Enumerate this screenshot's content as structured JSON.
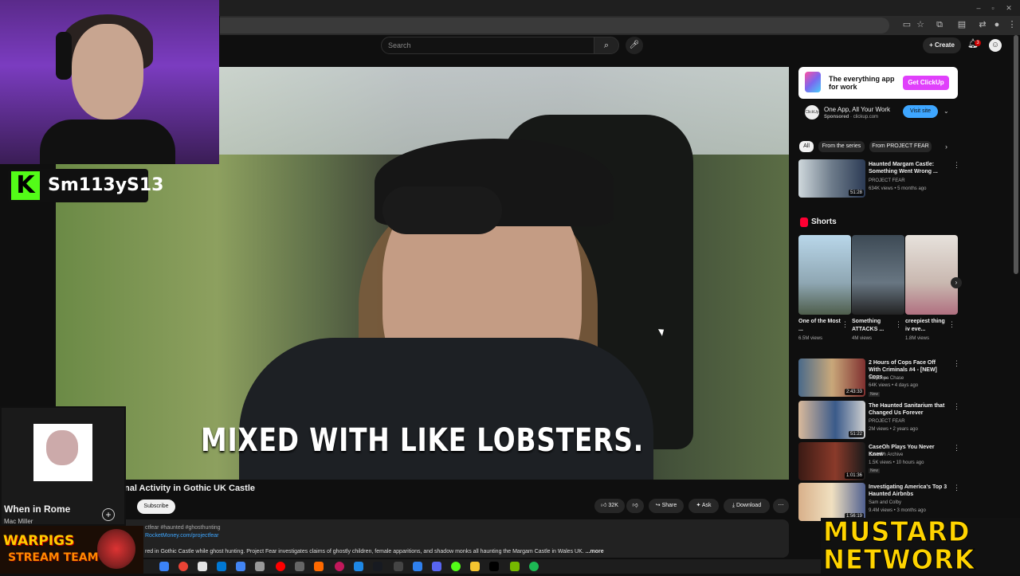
{
  "youtube": {
    "search_placeholder": "Search",
    "create_label": "Create",
    "notification_count": "3"
  },
  "video": {
    "caption": "MIXED WITH LIKE LOBSTERS.",
    "title_fragment": "nal Activity in Gothic UK Castle",
    "subscribe_label": "Subscribe",
    "likes": "32K",
    "share_label": "Share",
    "ask_label": "Ask",
    "download_label": "Download",
    "desc_tags": "ctfear #haunted #ghosthunting",
    "desc_link": "RocketMoney.com/projectfear",
    "desc_text": "red in Gothic Castle while ghost hunting. Project Fear investigates claims of ghostly children, female apparitions,  and shadow monks all haunting the Margam Castle in Wales UK.",
    "desc_more": "...more"
  },
  "ad": {
    "headline": "The everything app for work",
    "cta": "Get ClickUp",
    "icon_text": "ClickUp",
    "title": "One App, All Your Work",
    "sponsored": "Sponsored",
    "domain": "clickup.com",
    "visit": "Visit site"
  },
  "chips": [
    "All",
    "From the series",
    "From PROJECT FEAR"
  ],
  "recommended": [
    {
      "title": "Haunted Margam Castle: Something Went Wrong ...",
      "channel": "PROJECT FEAR",
      "meta": "634K views • 5 months ago",
      "duration": "51:28",
      "badge": ""
    },
    {
      "title": "2 Hours of Cops Face Off With Criminals #4 - [NEW] Cops ...",
      "channel": "911 Cops Chase",
      "meta": "64K views • 4 days ago",
      "duration": "2:43:33",
      "badge": "New"
    },
    {
      "title": "The Haunted Sanitarium that Changed Us Forever",
      "channel": "PROJECT FEAR",
      "meta": "2M views • 2 years ago",
      "duration": "51:22",
      "badge": ""
    },
    {
      "title": "CaseOh Plays You Never Knew",
      "channel": "CaseOh Archive",
      "meta": "1.5K views • 10 hours ago",
      "duration": "1:01:36",
      "badge": "New"
    },
    {
      "title": "Investigating America's Top 3 Haunted Airbnbs",
      "channel": "Sam and Colby",
      "meta": "9.4M views • 3 months ago",
      "duration": "1:56:19",
      "badge": ""
    }
  ],
  "shorts": {
    "label": "Shorts",
    "items": [
      {
        "title": "One of the Most ...",
        "views": "6.5M views"
      },
      {
        "title": "Something ATTACKS ...",
        "views": "4M views"
      },
      {
        "title": "creepiest thing iv eve...",
        "views": "1.8M views"
      }
    ]
  },
  "overlay": {
    "streamer": "Sm113yS13",
    "kick_glyph": "K",
    "song": "When in Rome",
    "artist": "Mac Miller",
    "team_l1": "WARPIGS",
    "team_l2": "STREAM TEAM",
    "network_l1": "MUSTARD",
    "network_l2": "NETWORK"
  },
  "colors": {
    "youtube_bg": "#0f0f0f",
    "kick_green": "#53fc18",
    "clickup_pink": "#e040fb",
    "mustard": "#ffd400"
  }
}
